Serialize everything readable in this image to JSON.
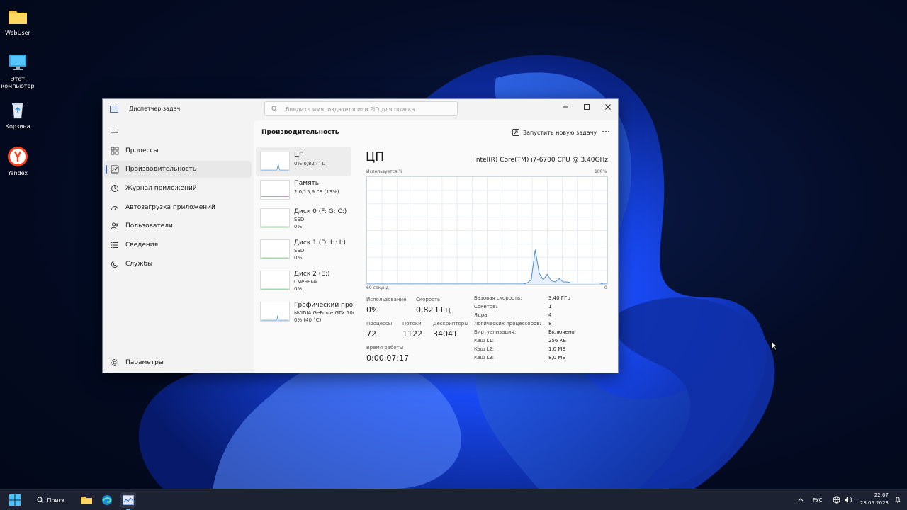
{
  "desktop": {
    "icons": [
      {
        "label": "WebUser"
      },
      {
        "label": "Этот компьютер"
      },
      {
        "label": "Корзина"
      },
      {
        "label": "Yandex"
      }
    ]
  },
  "window": {
    "title": "Диспетчер задач",
    "search_placeholder": "Введите имя, издателя или PID для поиска"
  },
  "sidebar": {
    "items": [
      {
        "label": "Процессы"
      },
      {
        "label": "Производительность"
      },
      {
        "label": "Журнал приложений"
      },
      {
        "label": "Автозагрузка приложений"
      },
      {
        "label": "Пользователи"
      },
      {
        "label": "Сведения"
      },
      {
        "label": "Службы"
      }
    ],
    "settings_label": "Параметры"
  },
  "content": {
    "page_title": "Производительность",
    "run_task_label": "Запустить новую задачу"
  },
  "resources": [
    {
      "name": "ЦП",
      "sub1": "0% 0,82 ГГц",
      "sub2": ""
    },
    {
      "name": "Память",
      "sub1": "2,0/15,9 ГБ (13%)",
      "sub2": ""
    },
    {
      "name": "Диск 0 (F: G: C:)",
      "sub1": "SSD",
      "sub2": "0%"
    },
    {
      "name": "Диск 1 (D: H: I:)",
      "sub1": "SSD",
      "sub2": "0%"
    },
    {
      "name": "Диск 2 (E:)",
      "sub1": "Сменный",
      "sub2": "0%"
    },
    {
      "name": "Графический про",
      "sub1": "NVIDIA GeForce GTX 106",
      "sub2": "0% (40 °C)"
    }
  ],
  "detail": {
    "title": "ЦП",
    "model": "Intel(R) Core(TM) i7-6700 CPU @ 3.40GHz",
    "y_label": "Используется %",
    "y_max": "100%",
    "x_label": "60 секунд",
    "x_min": "0",
    "stats": {
      "usage_label": "Использование",
      "usage_value": "0%",
      "speed_label": "Скорость",
      "speed_value": "0,82 ГГц",
      "processes_label": "Процессы",
      "processes_value": "72",
      "threads_label": "Потоки",
      "threads_value": "1122",
      "handles_label": "Дескрипторы",
      "handles_value": "34041",
      "uptime_label": "Время работы",
      "uptime_value": "0:00:07:17"
    },
    "specs": [
      {
        "k": "Базовая скорость:",
        "v": "3,40 ГГц"
      },
      {
        "k": "Сокетов:",
        "v": "1"
      },
      {
        "k": "Ядра:",
        "v": "4"
      },
      {
        "k": "Логических процессоров:",
        "v": "8"
      },
      {
        "k": "Виртуализация:",
        "v": "Включено"
      },
      {
        "k": "Кэш L1:",
        "v": "256 КБ"
      },
      {
        "k": "Кэш L2:",
        "v": "1,0 МБ"
      },
      {
        "k": "Кэш L3:",
        "v": "8,0 МБ"
      }
    ]
  },
  "chart_data": {
    "type": "line",
    "ylim": [
      0,
      100
    ],
    "x": [
      0,
      1,
      2,
      3,
      4,
      5,
      6,
      7,
      8,
      9,
      10,
      11,
      12,
      13,
      14,
      15,
      16,
      17,
      18,
      19,
      20,
      21,
      22,
      23,
      24,
      25,
      26,
      27,
      28,
      29,
      30,
      31,
      32,
      33,
      34,
      35,
      36,
      37,
      38,
      39,
      40,
      41,
      42,
      43,
      44,
      45,
      46,
      47,
      48,
      49,
      50,
      51,
      52,
      53,
      54,
      55,
      56,
      57,
      58,
      59,
      60
    ],
    "values": [
      0,
      0,
      0,
      0,
      0,
      0,
      0,
      0,
      0,
      0,
      0,
      0,
      0,
      0,
      0,
      0,
      0,
      0,
      0,
      0,
      0,
      0,
      0,
      0,
      0,
      0,
      0,
      0,
      0,
      0,
      0,
      0,
      0,
      0,
      0,
      0,
      0,
      0,
      0,
      0,
      0,
      0,
      0,
      0,
      0,
      0,
      0,
      0,
      0,
      0,
      0,
      0,
      0,
      0,
      0,
      0,
      0,
      0,
      0,
      0,
      0
    ],
    "series": [
      {
        "values": [
          0,
          0,
          0,
          0,
          0,
          0,
          0,
          0,
          0,
          0,
          0,
          0,
          0,
          0,
          0,
          0,
          0,
          0,
          0,
          0,
          0,
          0,
          0,
          0,
          0,
          0,
          0,
          0,
          0,
          0,
          0,
          0,
          0,
          0,
          0,
          0,
          0,
          0,
          0,
          0,
          0,
          0,
          0,
          0,
          0,
          0,
          0,
          0,
          0,
          0,
          0,
          0,
          0,
          0,
          0,
          0,
          0,
          0,
          0,
          0,
          0
        ]
      }
    ],
    "cpu_history": [
      0,
      0,
      0,
      0,
      0,
      0,
      0,
      0,
      0,
      0,
      0,
      0,
      0,
      0,
      0,
      0,
      0,
      0,
      0,
      0,
      0,
      0,
      0,
      0,
      0,
      0,
      0,
      0,
      0,
      0,
      0,
      0,
      0,
      0,
      0,
      0,
      0,
      0,
      0,
      0,
      0,
      0,
      0,
      0,
      0,
      0,
      0,
      0,
      0,
      0,
      0,
      0,
      0,
      0,
      0,
      0,
      0,
      0,
      0,
      0,
      0
    ]
  },
  "cpu_trace": [
    0,
    0,
    0,
    0,
    0,
    0,
    0,
    0,
    0,
    0,
    0,
    0,
    0,
    0,
    0,
    0,
    0,
    0,
    0,
    0,
    0,
    0,
    0,
    0,
    0,
    0,
    0,
    0,
    0,
    0,
    0,
    0,
    0,
    0,
    0,
    0,
    0,
    0,
    0,
    0,
    1,
    4,
    32,
    10,
    4,
    9,
    3,
    2,
    5,
    2,
    2,
    1,
    1,
    1,
    1,
    1,
    1,
    1,
    1,
    0,
    0
  ],
  "taskbar": {
    "search_label": "Поиск",
    "lang": "РУС",
    "time": "22:07",
    "date": "23.05.2023"
  }
}
